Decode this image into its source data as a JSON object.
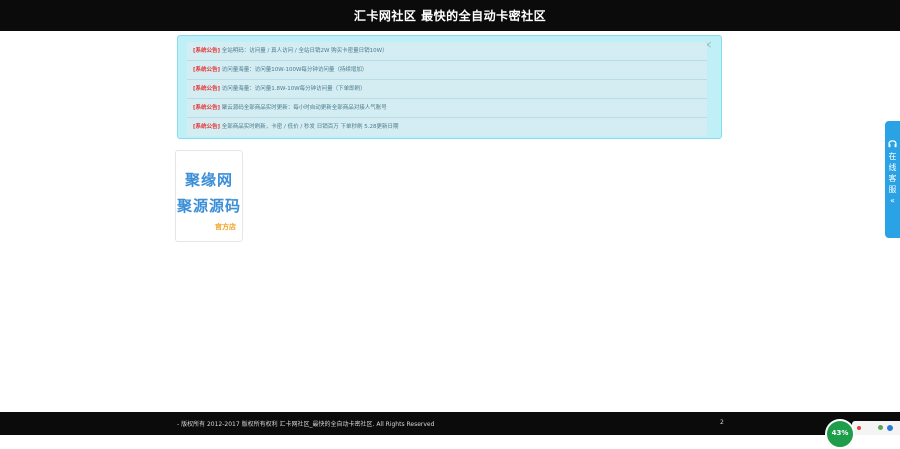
{
  "header": {
    "title": "汇卡网社区 最快的全自动卡密社区"
  },
  "notice": {
    "close_glyph": "×",
    "rows": [
      {
        "tag": "[系统公告]",
        "text": " 全站明码：访问量 / 真人访问 / 全站日销2W 购买卡密量日销10W）"
      },
      {
        "tag": "[系统公告]",
        "text": " 访问量海量：访问量10W-100W每分钟访问量（持续增加）"
      },
      {
        "tag": "[系统公告]",
        "text": " 访问量海量：访问量1.8W-10W每分钟访问量（下单即刷）"
      },
      {
        "tag": "[系统公告]",
        "text": " 聚云源码全部商品实时更新：每小时自动更新全部商品对接人气账号"
      },
      {
        "tag": "[系统公告]",
        "text": " 全部商品实时刷新，卡密 / 低价 / 秒发 日销百万 下单秒刷 5.28更新日期"
      }
    ]
  },
  "logo": {
    "line1": "聚缘网",
    "line2": "聚源源码",
    "sub": "官方店"
  },
  "online_service": {
    "label": "在线客服",
    "chevron": "«"
  },
  "footer": {
    "copyright": "- 版权所有 2012-2017 版权所有权利 汇卡网社区_最快的全自动卡密社区. All Rights Reserved",
    "page_number": "2"
  },
  "speed_badge": {
    "value": "43%"
  },
  "colors": {
    "accent": "#2aa3e6",
    "tag_red": "#e53535",
    "notice_bg": "#bff0f8"
  }
}
